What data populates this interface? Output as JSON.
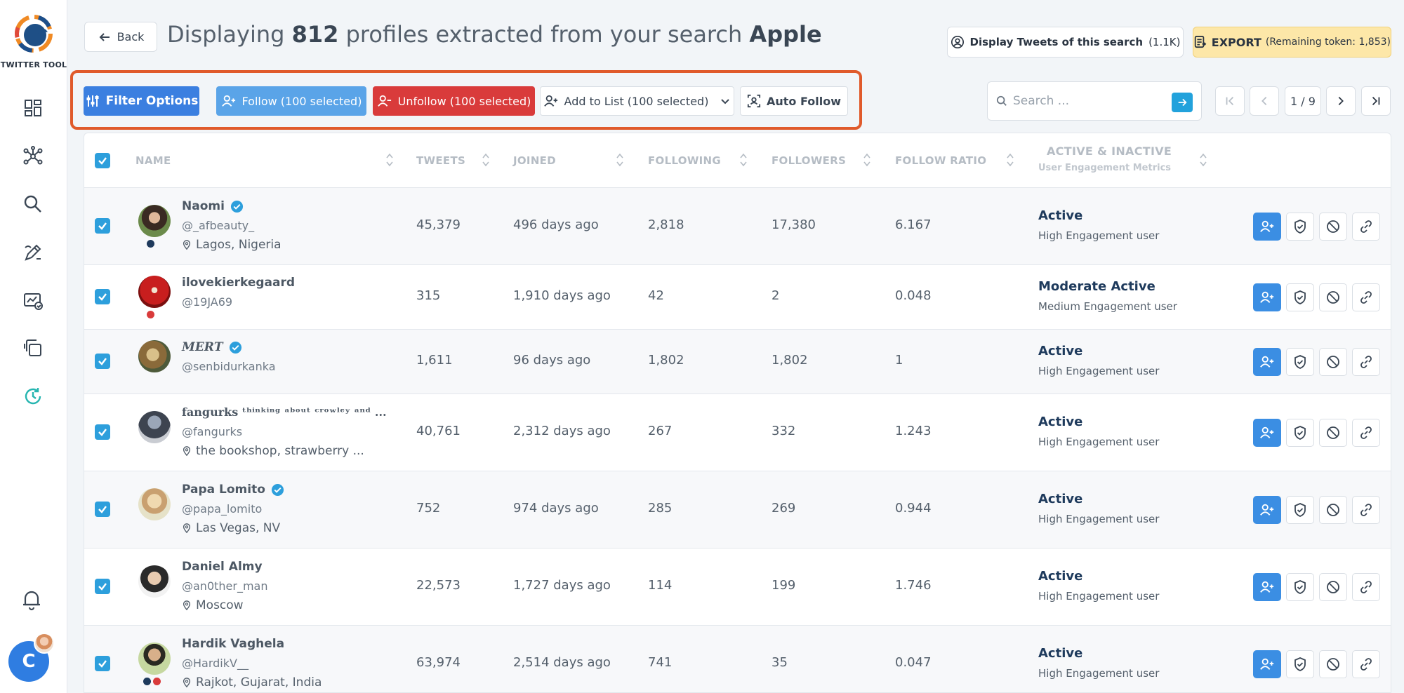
{
  "app": {
    "logo_text": "TWITTER TOOL"
  },
  "sidebar": {
    "items": [
      {
        "name": "dashboard-icon"
      },
      {
        "name": "network-icon"
      },
      {
        "name": "search-icon"
      },
      {
        "name": "edit-icon"
      },
      {
        "name": "analytics-icon"
      },
      {
        "name": "copy-icon"
      },
      {
        "name": "sync-icon"
      }
    ],
    "user_initial": "C"
  },
  "header": {
    "back_label": "Back",
    "title_prefix": "Displaying ",
    "title_count": "812",
    "title_middle": " profiles extracted from your search ",
    "title_query": "Apple",
    "tweets_label": "Display Tweets of this search",
    "tweets_count": "(1.1K)",
    "export_label": "EXPORT",
    "export_tokens": "(Remaining token: 1,853)"
  },
  "toolbar": {
    "filter_label": "Filter Options",
    "follow_label": "Follow (100 selected)",
    "unfollow_label": "Unfollow (100 selected)",
    "list_label": "Add to List (100 selected)",
    "auto_label": "Auto Follow"
  },
  "search": {
    "placeholder": "Search ..."
  },
  "pagination": {
    "label": "1 / 9"
  },
  "table": {
    "columns": {
      "name": "NAME",
      "tweets": "TWEETS",
      "joined": "JOINED",
      "following": "FOLLOWING",
      "followers": "FOLLOWERS",
      "ratio": "FOLLOW RATIO",
      "activity": "ACTIVE & INACTIVE",
      "activity_sub": "User Engagement Metrics"
    },
    "rows": [
      {
        "name": "Naomi",
        "verified": true,
        "handle": "@_afbeauty_",
        "location": "Lagos, Nigeria",
        "tweets": "45,379",
        "joined": "496 days ago",
        "following": "2,818",
        "followers": "17,380",
        "ratio": "6.167",
        "status": "Active",
        "engagement": "High Engagement user"
      },
      {
        "name": "ilovekierkegaard",
        "verified": false,
        "handle": "@19JA69",
        "location": "",
        "tweets": "315",
        "joined": "1,910 days ago",
        "following": "42",
        "followers": "2",
        "ratio": "0.048",
        "status": "Moderate Active",
        "engagement": "Medium Engagement user"
      },
      {
        "name": "𝑴𝑬𝑹𝑻",
        "verified": true,
        "handle": "@senbidurkanka",
        "location": "",
        "tweets": "1,611",
        "joined": "96 days ago",
        "following": "1,802",
        "followers": "1,802",
        "ratio": "1",
        "status": "Active",
        "engagement": "High Engagement user"
      },
      {
        "name": "fangurks ᵗʰⁱⁿᵏⁱⁿᵍ ᵃᵇᵒᵘᵗ ᶜʳᵒʷˡᵉʸ ᵃⁿᵈ ...",
        "verified": false,
        "handle": "@fangurks",
        "location": "the bookshop, strawberry ...",
        "tweets": "40,761",
        "joined": "2,312 days ago",
        "following": "267",
        "followers": "332",
        "ratio": "1.243",
        "status": "Active",
        "engagement": "High Engagement user"
      },
      {
        "name": "Papa Lomito",
        "verified": true,
        "handle": "@papa_lomito",
        "location": "Las Vegas, NV",
        "tweets": "752",
        "joined": "974 days ago",
        "following": "285",
        "followers": "269",
        "ratio": "0.944",
        "status": "Active",
        "engagement": "High Engagement user"
      },
      {
        "name": "Daniel Almy",
        "verified": false,
        "handle": "@an0ther_man",
        "location": "Moscow",
        "tweets": "22,573",
        "joined": "1,727 days ago",
        "following": "114",
        "followers": "199",
        "ratio": "1.746",
        "status": "Active",
        "engagement": "High Engagement user"
      },
      {
        "name": "Hardik Vaghela",
        "verified": false,
        "handle": "@HardikV__",
        "location": "Rajkot, Gujarat, India",
        "tweets": "63,974",
        "joined": "2,514 days ago",
        "following": "741",
        "followers": "35",
        "ratio": "0.047",
        "status": "Active",
        "engagement": "High Engagement user"
      }
    ]
  },
  "colors": {
    "primary": "#3b7fe0",
    "danger": "#d93b3b",
    "highlight": "#e05a2b",
    "export_bg": "#fde7a8",
    "status_text": "#1e3a5c"
  }
}
